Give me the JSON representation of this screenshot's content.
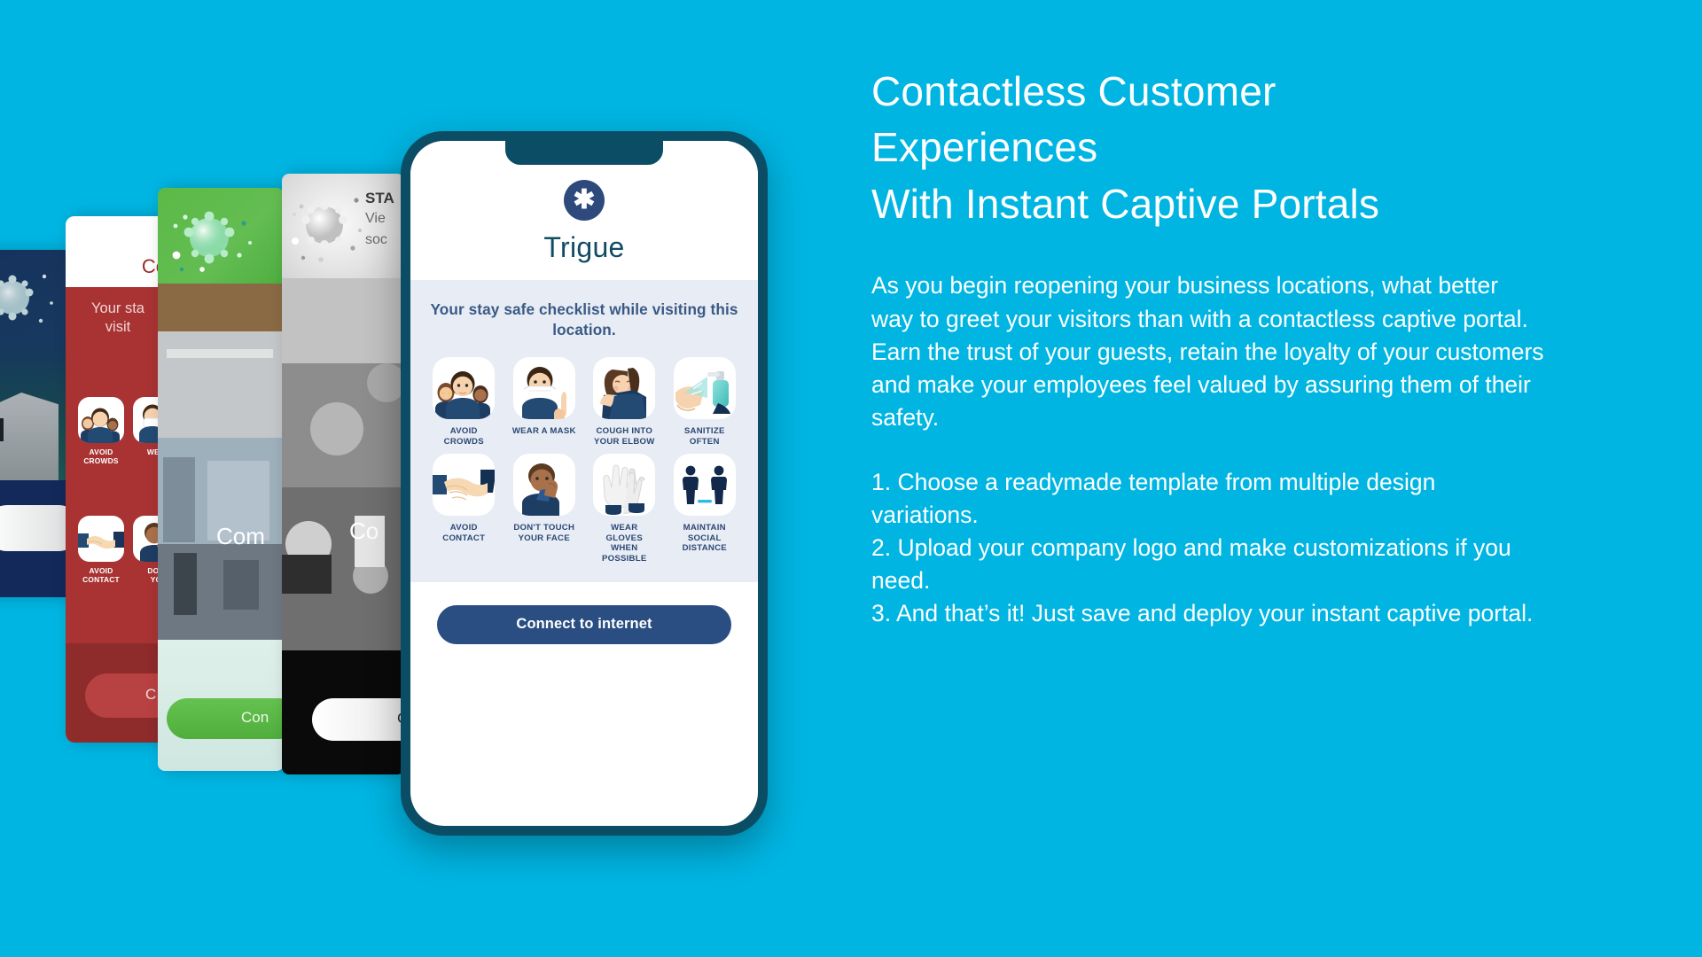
{
  "background_color": "#00b5e2",
  "marketing": {
    "headline": "Contactless Customer\nExperiences\nWith Instant Captive Portals",
    "body": "As you begin reopening your business locations, what better way to greet your visitors than with a contactless captive portal. Earn the trust of your guests, retain the loyalty of your customers and make your employees feel valued by assuring them of their safety.",
    "steps": [
      "1. Choose a readymade template from multiple design variations.",
      "2. Upload your company logo and make customizations if you need.",
      "3. And that’s it! Just save and deploy your instant captive portal."
    ]
  },
  "phone": {
    "logo_glyph": "✱",
    "brand": "Trigue",
    "checklist_title": "Your stay safe checklist while visiting this location.",
    "checklist": [
      {
        "icon": "avoid-crowds-icon",
        "label": "AVOID\nCROWDS"
      },
      {
        "icon": "wear-a-mask-icon",
        "label": "WEAR A MASK"
      },
      {
        "icon": "cough-into-elbow-icon",
        "label": "COUGH INTO\nYOUR ELBOW"
      },
      {
        "icon": "sanitize-often-icon",
        "label": "SANITIZE\nOFTEN"
      },
      {
        "icon": "avoid-contact-icon",
        "label": "AVOID\nCONTACT"
      },
      {
        "icon": "dont-touch-face-icon",
        "label": "DON’T TOUCH\nYOUR FACE"
      },
      {
        "icon": "wear-gloves-icon",
        "label": "WEAR\nGLOVES\nWHEN\nPOSSIBLE"
      },
      {
        "icon": "social-distance-icon",
        "label": "MAINTAIN\nSOCIAL\nDISTANCE"
      }
    ],
    "connect_button": "Connect to internet",
    "colors": {
      "frame": "#0c4d66",
      "logo_circle": "#2e4a7d",
      "brand_text": "#0f4d63",
      "panel": "#e8ecf4",
      "label_text": "#2c4875",
      "button": "#2a4e82"
    }
  },
  "background_templates": [
    {
      "name": "navy-template",
      "accent": "#12295a",
      "button_label": "",
      "button_style": "white-pill"
    },
    {
      "name": "red-template",
      "accent": "#a93333",
      "title_fragment": "Co",
      "subtitle": "Your stay safe checklist while visiting this location.",
      "labels": [
        "AVOID CROWDS",
        "WEAR A MASK",
        "AVOID CONTACT",
        "DON’T TOUCH YOUR FACE"
      ],
      "button_label": "C",
      "button_style": "dark-red-pill"
    },
    {
      "name": "green-template",
      "accent": "#5cb947",
      "title_fragment": "Com",
      "button_label": "Con",
      "button_style": "green-pill"
    },
    {
      "name": "grey-template",
      "accent": "#cfcfcf",
      "heading_fragment": "STA",
      "line2_fragment": "Vie",
      "line3_fragment": "soc",
      "title_fragment": "Co",
      "button_label": "C",
      "button_style": "white-pill"
    }
  ]
}
